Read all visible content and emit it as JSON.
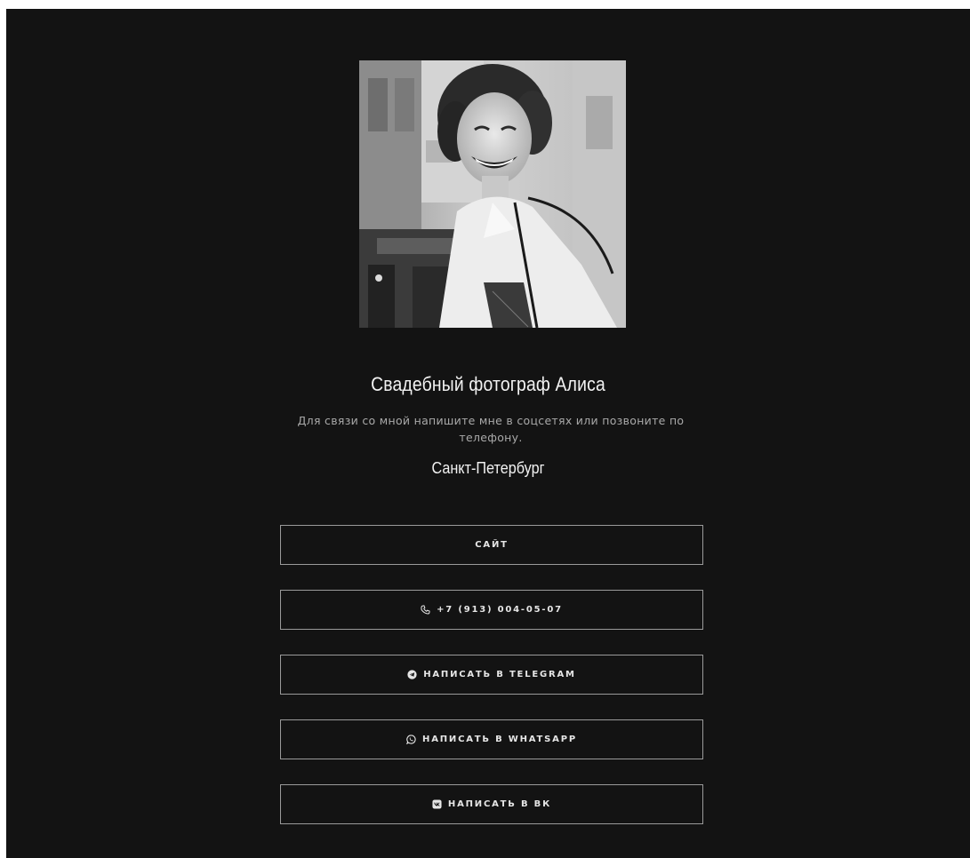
{
  "profile": {
    "photo_alt": "smiling-woman-portrait",
    "title": "Свадебный фотограф Алиса",
    "description": "Для связи со мной напишите мне в соцсетях или позвоните по телефону.",
    "city": "Санкт-Петербург"
  },
  "buttons": {
    "site": {
      "label": "САЙТ"
    },
    "phone": {
      "label": "+7 (913) 004-05-07",
      "icon": "phone-icon"
    },
    "telegram": {
      "label": "НАПИСАТЬ В TELEGRAM",
      "icon": "telegram-icon"
    },
    "whatsapp": {
      "label": "НАПИСАТЬ В WHATSAPP",
      "icon": "whatsapp-icon"
    },
    "vk": {
      "label": "НАПИСАТЬ В ВК",
      "icon": "vk-icon"
    }
  },
  "colors": {
    "background": "#131313",
    "text": "#f2f2f2",
    "muted": "#a9a9a9",
    "border": "#9a9a9a"
  }
}
